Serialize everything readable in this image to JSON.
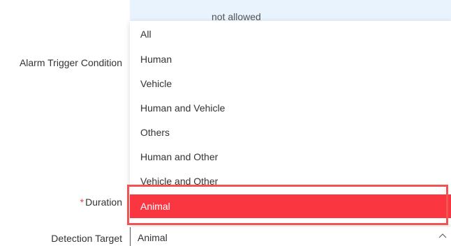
{
  "banner": {
    "text": "not allowed"
  },
  "form": {
    "alarm_trigger_label": "Alarm Trigger Condition",
    "duration_label": "Duration",
    "duration_required_mark": "*",
    "detection_target_label": "Detection Target"
  },
  "dropdown": {
    "items": [
      {
        "label": "All"
      },
      {
        "label": "Human"
      },
      {
        "label": "Vehicle"
      },
      {
        "label": "Human and Vehicle"
      },
      {
        "label": "Others"
      },
      {
        "label": "Human and Other"
      },
      {
        "label": "Vehicle and Other"
      },
      {
        "label": "Animal"
      }
    ],
    "selected_label": "Animal"
  },
  "select": {
    "value": "Animal",
    "icon": "chevron-up-icon"
  },
  "colors": {
    "selected_bg": "#fa3640",
    "highlight_border": "#f05454",
    "banner_bg": "#e8f3fd",
    "required": "#f23d3d"
  }
}
